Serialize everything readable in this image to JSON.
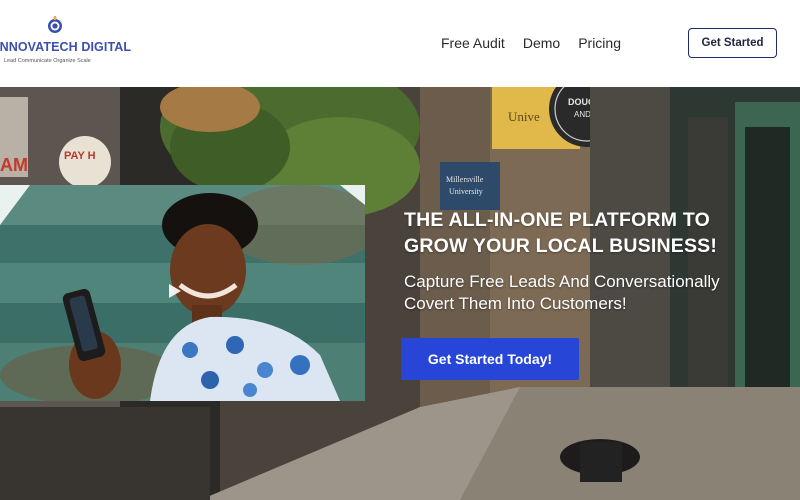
{
  "brand": {
    "name": "INNOVATECH DIGITAL",
    "tagline": "Lead Communicate Organize Scale",
    "logo_icon": "brand-globe-icon"
  },
  "nav": {
    "items": [
      {
        "label": "Free Audit"
      },
      {
        "label": "Demo"
      },
      {
        "label": "Pricing"
      }
    ],
    "cta_label": "Get Started"
  },
  "hero": {
    "headline_line1": "THE ALL-IN-ONE PLATFORM TO",
    "headline_line2": "GROW YOUR LOCAL BUSINESS!",
    "subhead": "Capture Free Leads And Conversationally Covert Them Into Customers!",
    "cta_label": "Get Started Today!",
    "video_icon": "play-icon",
    "background_signs": [
      "PAY H",
      "AM",
      "DOUGH AND CO",
      "Millersville University",
      "Unive"
    ]
  },
  "colors": {
    "brand_blue": "#3b4fb0",
    "cta_blue": "#2745d6",
    "header_cta_border": "#1f2a6e"
  }
}
